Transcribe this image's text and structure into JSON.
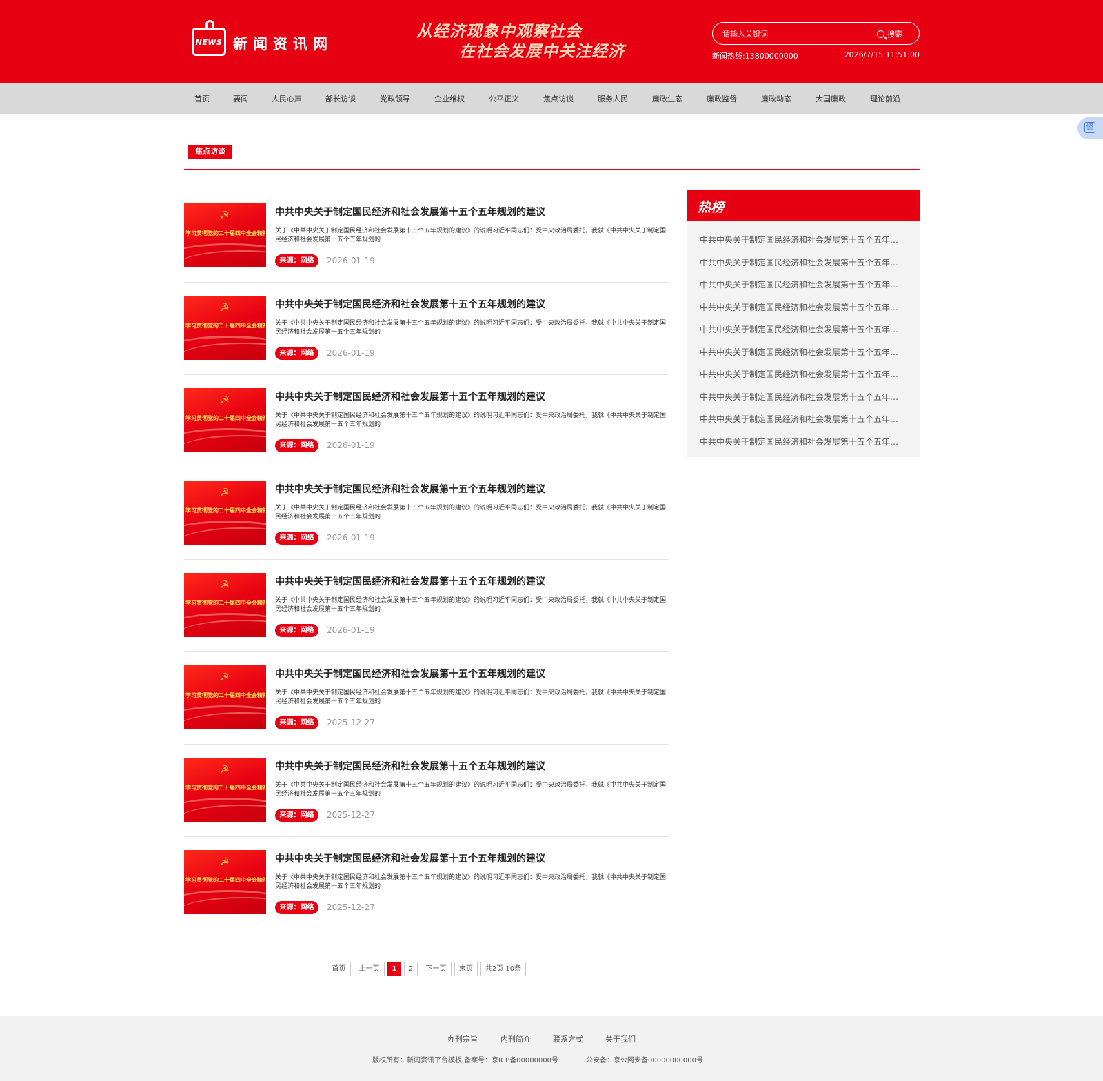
{
  "header": {
    "logo_badge": "NEWS",
    "logo_text": "新闻资讯网",
    "slogan_line1": "从经济现象中观察社会",
    "slogan_line2": "在社会发展中关注经济",
    "search_placeholder": "请输入关键词",
    "search_button": "搜索",
    "hotline": "新闻热线:13800000000",
    "datetime": "2026/7/15 11:51:00"
  },
  "nav": [
    "首页",
    "要闻",
    "人民心声",
    "部长访谈",
    "党政领导",
    "企业维权",
    "公平正义",
    "焦点访谈",
    "服务人民",
    "廉政生态",
    "廉政监督",
    "廉政动态",
    "大国廉政",
    "理论前沿"
  ],
  "translate_label": "译",
  "section_tag": "焦点访谈",
  "thumb": {
    "emblem": "☭",
    "caption": "学习贯彻党的二十届四中全会精神"
  },
  "articles": [
    {
      "title": "中共中央关于制定国民经济和社会发展第十五个五年规划的建议",
      "summary": "关于《中共中央关于制定国民经济和社会发展第十五个五年规划的建议》的说明习近平同志们：受中央政治局委托，我就《中共中央关于制定国民经济和社会发展第十五个五年规划的",
      "source": "来源：网络",
      "date": "2026-01-19"
    },
    {
      "title": "中共中央关于制定国民经济和社会发展第十五个五年规划的建议",
      "summary": "关于《中共中央关于制定国民经济和社会发展第十五个五年规划的建议》的说明习近平同志们：受中央政治局委托，我就《中共中央关于制定国民经济和社会发展第十五个五年规划的",
      "source": "来源：网络",
      "date": "2026-01-19"
    },
    {
      "title": "中共中央关于制定国民经济和社会发展第十五个五年规划的建议",
      "summary": "关于《中共中央关于制定国民经济和社会发展第十五个五年规划的建议》的说明习近平同志们：受中央政治局委托，我就《中共中央关于制定国民经济和社会发展第十五个五年规划的",
      "source": "来源：网络",
      "date": "2026-01-19"
    },
    {
      "title": "中共中央关于制定国民经济和社会发展第十五个五年规划的建议",
      "summary": "关于《中共中央关于制定国民经济和社会发展第十五个五年规划的建议》的说明习近平同志们：受中央政治局委托，我就《中共中央关于制定国民经济和社会发展第十五个五年规划的",
      "source": "来源：网络",
      "date": "2026-01-19"
    },
    {
      "title": "中共中央关于制定国民经济和社会发展第十五个五年规划的建议",
      "summary": "关于《中共中央关于制定国民经济和社会发展第十五个五年规划的建议》的说明习近平同志们：受中央政治局委托，我就《中共中央关于制定国民经济和社会发展第十五个五年规划的",
      "source": "来源：网络",
      "date": "2026-01-19"
    },
    {
      "title": "中共中央关于制定国民经济和社会发展第十五个五年规划的建议",
      "summary": "关于《中共中央关于制定国民经济和社会发展第十五个五年规划的建议》的说明习近平同志们：受中央政治局委托，我就《中共中央关于制定国民经济和社会发展第十五个五年规划的",
      "source": "来源：网络",
      "date": "2025-12-27"
    },
    {
      "title": "中共中央关于制定国民经济和社会发展第十五个五年规划的建议",
      "summary": "关于《中共中央关于制定国民经济和社会发展第十五个五年规划的建议》的说明习近平同志们：受中央政治局委托，我就《中共中央关于制定国民经济和社会发展第十五个五年规划的",
      "source": "来源：网络",
      "date": "2025-12-27"
    },
    {
      "title": "中共中央关于制定国民经济和社会发展第十五个五年规划的建议",
      "summary": "关于《中共中央关于制定国民经济和社会发展第十五个五年规划的建议》的说明习近平同志们：受中央政治局委托，我就《中共中央关于制定国民经济和社会发展第十五个五年规划的",
      "source": "来源：网络",
      "date": "2025-12-27"
    }
  ],
  "pagination": {
    "first": "首页",
    "prev": "上一页",
    "pages": [
      "1",
      "2"
    ],
    "current": "1",
    "next": "下一页",
    "last": "末页",
    "summary": "共2页 10条"
  },
  "hot": {
    "title": "热榜",
    "items": [
      "中共中央关于制定国民经济和社会发展第十五个五年规划的建议",
      "中共中央关于制定国民经济和社会发展第十五个五年规划的建议",
      "中共中央关于制定国民经济和社会发展第十五个五年规划的建议",
      "中共中央关于制定国民经济和社会发展第十五个五年规划的建议",
      "中共中央关于制定国民经济和社会发展第十五个五年规划的建议",
      "中共中央关于制定国民经济和社会发展第十五个五年规划的建议",
      "中共中央关于制定国民经济和社会发展第十五个五年规划的建议",
      "中共中央关于制定国民经济和社会发展第十五个五年规划的建议",
      "中共中央关于制定国民经济和社会发展第十五个五年规划的建议",
      "中共中央关于制定国民经济和社会发展第十五个五年规划的建议"
    ]
  },
  "footer": {
    "links": [
      "办刊宗旨",
      "内刊简介",
      "联系方式",
      "关于我们"
    ],
    "copyright": "版权所有：新闻资讯平台模板 备案号：京ICP备00000000号",
    "police": "公安备：京公网安备00000000000号"
  },
  "colors": {
    "brand_red": "#e60012",
    "nav_bg": "#d9d9d9",
    "footer_bg": "#f2f2f2",
    "slogan": "#ffd6ba"
  }
}
